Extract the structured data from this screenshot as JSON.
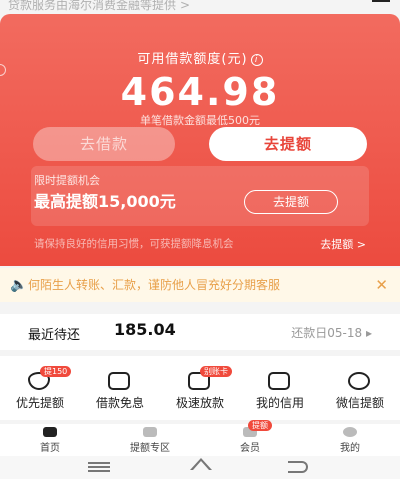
{
  "top_text": "贷款服务由海尔消费金融等提供",
  "top_arrow": ">",
  "card": {
    "title": "可用借款额度(元)",
    "info_icon": "i",
    "amount": "464.98",
    "subtitle": "单笔借款金额最低500元",
    "borrow_button": "去借款",
    "raise_button": "去提额"
  },
  "promo": {
    "label": "限时提额机会",
    "max_text": "最高提额15,000元",
    "button": "去提额"
  },
  "tip": {
    "text": "请保持良好的信用习惯，可获提额降息机会",
    "link": "去提额",
    "link_arrow": ">"
  },
  "notice": {
    "speaker": "🔈",
    "text": "何陌生人转账、汇款，谨防他人冒充好分期客服",
    "close": "✕"
  },
  "repay": {
    "label": "最近待还",
    "amount": "185.04",
    "date": "还款日05-18 ▸"
  },
  "services": [
    {
      "label": "优先提额",
      "badge": "提150",
      "icon": "heart-down-icon"
    },
    {
      "label": "借款免息",
      "badge": "",
      "icon": "yen-card-icon"
    },
    {
      "label": "极速放款",
      "badge": "别账卡",
      "icon": "card-icon"
    },
    {
      "label": "我的信用",
      "badge": "",
      "icon": "credit-doc-icon"
    },
    {
      "label": "微信提额",
      "badge": "",
      "icon": "chat-icon"
    }
  ],
  "tabs": [
    {
      "label": "首页",
      "badge": ""
    },
    {
      "label": "提额专区",
      "badge": ""
    },
    {
      "label": "会员",
      "badge": "提额"
    },
    {
      "label": "我的",
      "badge": ""
    }
  ],
  "colors": {
    "brand_red": "#ec4b3f",
    "notice_bg": "#fff8e8",
    "notice_text": "#e8a04a"
  }
}
